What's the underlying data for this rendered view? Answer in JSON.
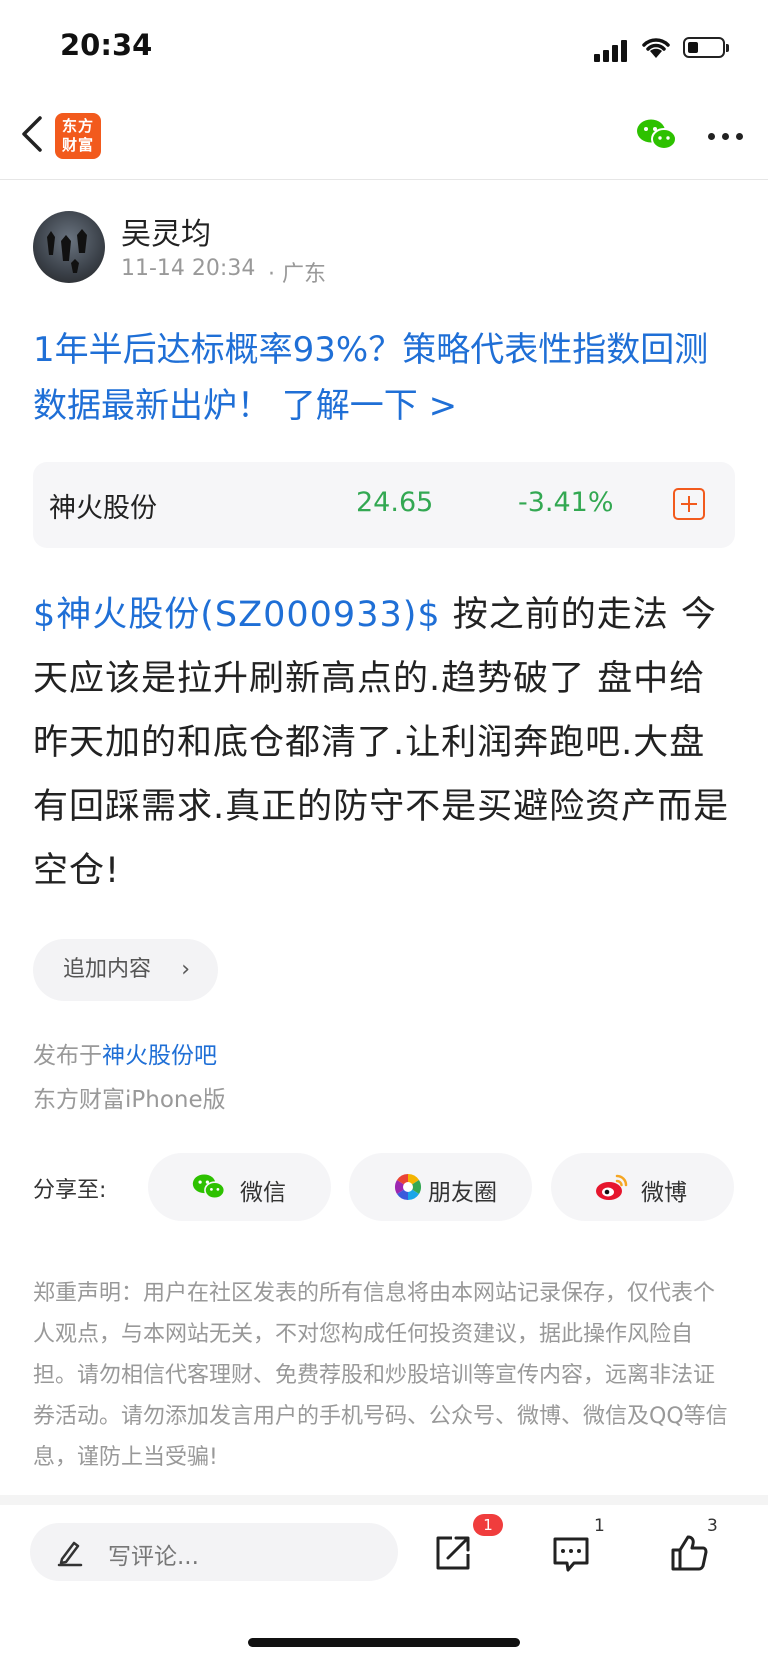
{
  "status_bar": {
    "time": "20:34"
  },
  "nav": {
    "logo_text_line1": "东方",
    "logo_text_line2": "财富"
  },
  "author": {
    "name": "吴灵均",
    "time": "11-14 20:34",
    "location": "· 广东"
  },
  "promo": {
    "text": "1年半后达标概率93%？策略代表性指数回测数据最新出炉！ 了解一下 >"
  },
  "stock": {
    "name": "神火股份",
    "price": "24.65",
    "change": "-3.41%",
    "color": "#33a852"
  },
  "post": {
    "tag": "$神火股份(SZ000933)$",
    "text": "  按之前的走法 今天应该是拉升刷新高点的.趋势破了 盘中给昨天加的和底仓都清了.让利润奔跑吧.大盘有回踩需求.真正的防守不是买避险资产而是空仓!"
  },
  "append_button": {
    "label": "追加内容"
  },
  "published": {
    "prefix": "发布于",
    "bar": "神火股份吧",
    "client": "东方财富iPhone版"
  },
  "share": {
    "label": "分享至:",
    "items": [
      {
        "label": "微信",
        "icon": "wechat-icon"
      },
      {
        "label": "朋友圈",
        "icon": "moments-icon"
      },
      {
        "label": "微博",
        "icon": "weibo-icon"
      }
    ]
  },
  "disclaimer": "郑重声明：用户在社区发表的所有信息将由本网站记录保存，仅代表个人观点，与本网站无关，不对您构成任何投资建议，据此操作风险自担。请勿相信代客理财、免费荐股和炒股培训等宣传内容，远离非法证券活动。请勿添加发言用户的手机号码、公众号、微博、微信及QQ等信息，谨防上当受骗!",
  "bottom_bar": {
    "comment_placeholder": "写评论...",
    "share_badge": "1",
    "comment_count": "1",
    "like_count": "3"
  },
  "colors": {
    "accent_blue": "#1f6fd6",
    "brand_orange": "#f25a1d",
    "down_green": "#33a852",
    "badge_red": "#f03d3d"
  }
}
